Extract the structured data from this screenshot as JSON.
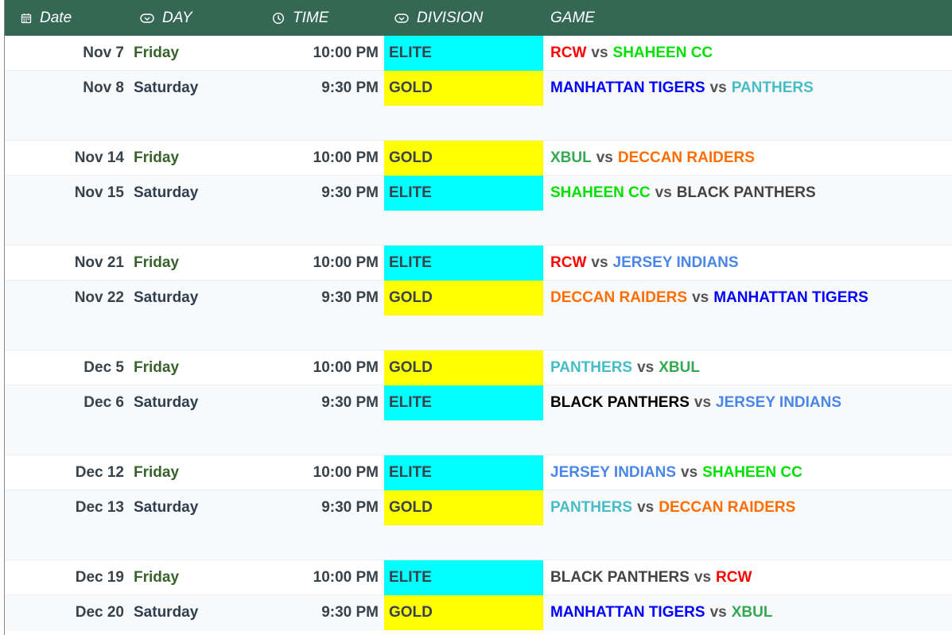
{
  "colors": {
    "header_bg": "#356854",
    "elite": "#00ffff",
    "gold": "#ffff00",
    "friday": "#37632a",
    "saturday": "#2f3e4e"
  },
  "header": {
    "date": "Date",
    "day": "DAY",
    "time": "TIME",
    "division": "DIVISION",
    "game": "GAME",
    "icons": [
      "calendar-icon",
      "dropdown-chip-icon",
      "clock-icon",
      "dropdown-chip-icon"
    ]
  },
  "team_colors": {
    "RCW": "#ff0000",
    "SHAHEEN CC": "#00e000",
    "MANHATTAN TIGERS": "#0000ff",
    "PANTHERS": "#46bdc6",
    "XBUL": "#34a853",
    "DECCAN RAIDERS": "#ff6d01",
    "BLACK PANTHERS": "#434343",
    "JERSEY INDIANS": "#4a86e8"
  },
  "vs_label": "vs",
  "rows": [
    {
      "type": "game",
      "date": "Nov 7",
      "day": "Friday",
      "time": "10:00 PM",
      "division": "ELITE",
      "home": "RCW",
      "away": "SHAHEEN CC"
    },
    {
      "type": "game",
      "date": "Nov 8",
      "day": "Saturday",
      "time": "9:30 PM",
      "division": "GOLD",
      "home": "MANHATTAN TIGERS",
      "away": "PANTHERS"
    },
    {
      "type": "spacer"
    },
    {
      "type": "game",
      "date": "Nov 14",
      "day": "Friday",
      "time": "10:00 PM",
      "division": "GOLD",
      "home": "XBUL",
      "away": "DECCAN RAIDERS"
    },
    {
      "type": "game",
      "date": "Nov 15",
      "day": "Saturday",
      "time": "9:30 PM",
      "division": "ELITE",
      "home": "SHAHEEN CC",
      "away": "BLACK PANTHERS"
    },
    {
      "type": "spacer"
    },
    {
      "type": "game",
      "date": "Nov 21",
      "day": "Friday",
      "time": "10:00 PM",
      "division": "ELITE",
      "home": "RCW",
      "away": "JERSEY INDIANS"
    },
    {
      "type": "game",
      "date": "Nov 22",
      "day": "Saturday",
      "time": "9:30 PM",
      "division": "GOLD",
      "home": "DECCAN RAIDERS",
      "away": "MANHATTAN TIGERS"
    },
    {
      "type": "spacer"
    },
    {
      "type": "game",
      "date": "Dec 5",
      "day": "Friday",
      "time": "10:00 PM",
      "division": "GOLD",
      "home": "PANTHERS",
      "away": "XBUL"
    },
    {
      "type": "game",
      "date": "Dec 6",
      "day": "Saturday",
      "time": "9:30 PM",
      "division": "ELITE",
      "home": "BLACK PANTHERS",
      "away": "JERSEY INDIANS",
      "home_color": "#000000"
    },
    {
      "type": "spacer"
    },
    {
      "type": "game",
      "date": "Dec 12",
      "day": "Friday",
      "time": "10:00 PM",
      "division": "ELITE",
      "home": "JERSEY INDIANS",
      "away": "SHAHEEN CC"
    },
    {
      "type": "game",
      "date": "Dec 13",
      "day": "Saturday",
      "time": "9:30 PM",
      "division": "GOLD",
      "home": "PANTHERS",
      "away": "DECCAN RAIDERS"
    },
    {
      "type": "spacer"
    },
    {
      "type": "game",
      "date": "Dec 19",
      "day": "Friday",
      "time": "10:00 PM",
      "division": "ELITE",
      "home": "BLACK PANTHERS",
      "away": "RCW"
    },
    {
      "type": "game",
      "date": "Dec 20",
      "day": "Saturday",
      "time": "9:30 PM",
      "division": "GOLD",
      "home": "MANHATTAN TIGERS",
      "away": "XBUL"
    }
  ]
}
